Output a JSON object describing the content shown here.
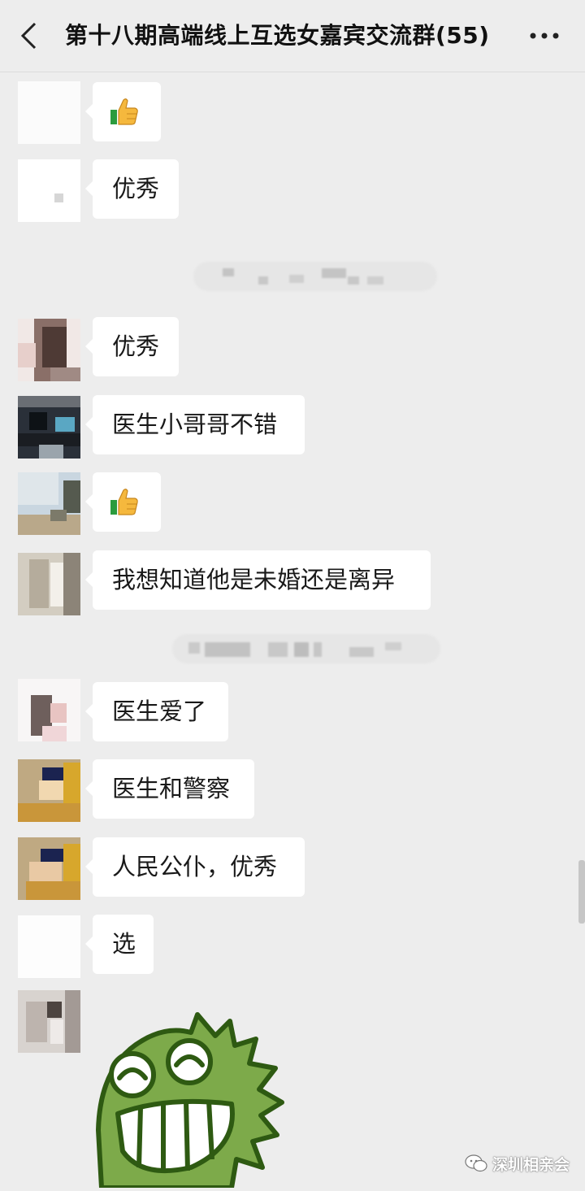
{
  "header": {
    "title": "第十八期高端线上互选女嘉宾交流群(55)"
  },
  "messages": [
    {
      "avatar": "avatar-1",
      "type": "emoji",
      "emoji": "thumbs-up-icon"
    },
    {
      "avatar": "avatar-2",
      "type": "text",
      "text": "优秀"
    },
    {
      "avatar": "avatar-3",
      "type": "text",
      "text": "优秀"
    },
    {
      "avatar": "avatar-4",
      "type": "text",
      "text": "医生小哥哥不错"
    },
    {
      "avatar": "avatar-5",
      "type": "emoji",
      "emoji": "thumbs-up-icon"
    },
    {
      "avatar": "avatar-6",
      "type": "text",
      "text": "我想知道他是未婚还是离异"
    },
    {
      "avatar": "avatar-7",
      "type": "text",
      "text": "医生爱了"
    },
    {
      "avatar": "avatar-8",
      "type": "text",
      "text": "医生和警察"
    },
    {
      "avatar": "avatar-9",
      "type": "text",
      "text": "人民公仆，优秀"
    },
    {
      "avatar": "avatar-10",
      "type": "text",
      "text": "选"
    },
    {
      "avatar": "avatar-11",
      "type": "sticker",
      "sticker": "green-dinosaur-laughing-sticker"
    }
  ],
  "watermark": {
    "text": "深圳相亲会"
  },
  "colors": {
    "background": "#ededed",
    "bubble": "#ffffff",
    "sticker_green": "#7daa4a",
    "sticker_outline": "#2e5a12"
  }
}
